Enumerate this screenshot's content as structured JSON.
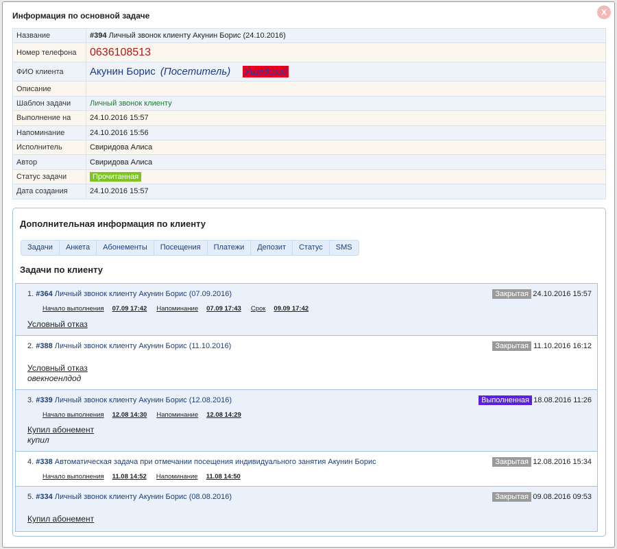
{
  "dialog": {
    "title": "Информация по основной задаче",
    "close": "X"
  },
  "info": {
    "rows": [
      {
        "label": "Название",
        "id": "#394",
        "value": " Личный звонок клиенту Акунин Борис (24.10.2016)"
      },
      {
        "label": "Номер телефона",
        "value": "0636108513"
      },
      {
        "label": "ФИО клиента",
        "name": "Акунин Борис",
        "role": "(Посетитель)",
        "badge": "Ушедший"
      },
      {
        "label": "Описание",
        "value": ""
      },
      {
        "label": "Шаблон задачи",
        "value": "Личный звонок клиенту"
      },
      {
        "label": "Выполнение на",
        "value": "24.10.2016 15:57"
      },
      {
        "label": "Напоминание",
        "value": "24.10.2016 15:56"
      },
      {
        "label": "Исполнитель",
        "value": "Свиридова Алиса"
      },
      {
        "label": "Автор",
        "value": "Свиридова Алиса"
      },
      {
        "label": "Статус задачи",
        "value": "Прочитанная"
      },
      {
        "label": "Дата создания",
        "value": "24.10.2016 15:57"
      }
    ]
  },
  "panel": {
    "title": "Дополнительная информация по клиенту",
    "tabs": [
      "Задачи",
      "Анкета",
      "Абонементы",
      "Посещения",
      "Платежи",
      "Депозит",
      "Статус",
      "SMS"
    ],
    "section_title": "Задачи по клиенту"
  },
  "tasks": [
    {
      "num": "1.",
      "id": "#364",
      "title": " Личный звонок клиенту Акунин Борис (07.09.2016)",
      "status": "Закрытая",
      "date": "24.10.2016 15:57",
      "meta": [
        [
          "Начало выполнения",
          "07.09 17:42"
        ],
        [
          "Напоминание",
          "07.09 17:43"
        ],
        [
          "Срок",
          "09.09 17:42"
        ]
      ],
      "result": "Условный отказ",
      "comment": ""
    },
    {
      "num": "2.",
      "id": "#388",
      "title": " Личный звонок клиенту Акунин Борис (11.10.2016)",
      "status": "Закрытая",
      "date": "11.10.2016 16:12",
      "meta": [],
      "result": "Условный отказ",
      "comment": "овекноенлдод"
    },
    {
      "num": "3.",
      "id": "#339",
      "title": " Личный звонок клиенту Акунин Борис (12.08.2016)",
      "status": "Выполненная",
      "date": "18.08.2016 11:26",
      "meta": [
        [
          "Начало выполнения",
          "12.08 14:30"
        ],
        [
          "Напоминание",
          "12.08 14:29"
        ]
      ],
      "result": "Купил абонемент",
      "comment": "купил"
    },
    {
      "num": "4.",
      "id": "#338",
      "title": " Автоматическая задача при отмечании посещения индивидуального занятия Акунин Борис",
      "status": "Закрытая",
      "date": "12.08.2016 15:34",
      "meta": [
        [
          "Начало выполнения",
          "11.08 14:52"
        ],
        [
          "Напоминание",
          "11.08 14:50"
        ]
      ],
      "result": "",
      "comment": ""
    },
    {
      "num": "5.",
      "id": "#334",
      "title": " Личный звонок клиенту Акунин Борис (08.08.2016)",
      "status": "Закрытая",
      "date": "09.08.2016 09:53",
      "meta": [],
      "result": "Купил абонемент",
      "comment": ""
    }
  ],
  "colors": {
    "status_closed": "#9a9a9a",
    "status_done": "#5b1fe0",
    "status_read": "#7cc71f",
    "badge_left": "#e8001c"
  }
}
